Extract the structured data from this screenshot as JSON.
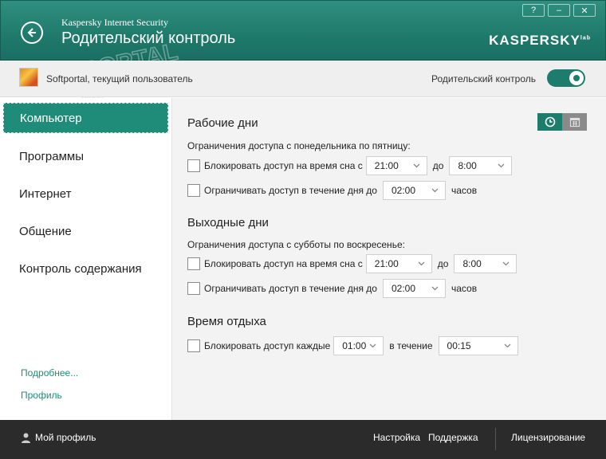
{
  "header": {
    "app_name": "Kaspersky Internet Security",
    "page_title": "Родительский контроль",
    "logo": "KASPERSKY",
    "logo_sup": "lab",
    "help": "?",
    "minimize": "–",
    "close": "✕"
  },
  "watermark": {
    "text": "PORTAL",
    "sub": "www.softportal.com"
  },
  "userbar": {
    "user_label": "Softportal, текущий пользователь",
    "toggle_label": "Родительский контроль",
    "toggle_on": true
  },
  "sidebar": {
    "items": [
      {
        "label": "Компьютер",
        "active": true
      },
      {
        "label": "Программы"
      },
      {
        "label": "Интернет"
      },
      {
        "label": "Общение"
      },
      {
        "label": "Контроль содержания"
      }
    ],
    "more_link": "Подробнее...",
    "profile_link": "Профиль"
  },
  "workdays": {
    "title": "Рабочие дни",
    "subtitle": "Ограничения доступа с понедельника по пятницу:",
    "sleep": {
      "label": "Блокировать доступ на время сна с",
      "from": "21:00",
      "to_label": "до",
      "to": "8:00",
      "checked": false
    },
    "daily": {
      "label": "Ограничивать доступ в течение дня до",
      "value": "02:00",
      "unit": "часов",
      "checked": false
    }
  },
  "weekend": {
    "title": "Выходные дни",
    "subtitle": "Ограничения доступа с субботы по воскресенье:",
    "sleep": {
      "label": "Блокировать доступ на время сна с",
      "from": "21:00",
      "to_label": "до",
      "to": "8:00",
      "checked": false
    },
    "daily": {
      "label": "Ограничивать доступ в течение дня до",
      "value": "02:00",
      "unit": "часов",
      "checked": false
    }
  },
  "rest": {
    "title": "Время отдыха",
    "label": "Блокировать доступ каждые",
    "every": "01:00",
    "for_label": "в течение",
    "duration": "00:15",
    "checked": false
  },
  "footer": {
    "my_profile": "Мой профиль",
    "settings": "Настройка",
    "support": "Поддержка",
    "licensing": "Лицензирование"
  },
  "colors": {
    "accent": "#1e8c79",
    "header": "#1f7a6b",
    "footer": "#2b2b2b"
  }
}
